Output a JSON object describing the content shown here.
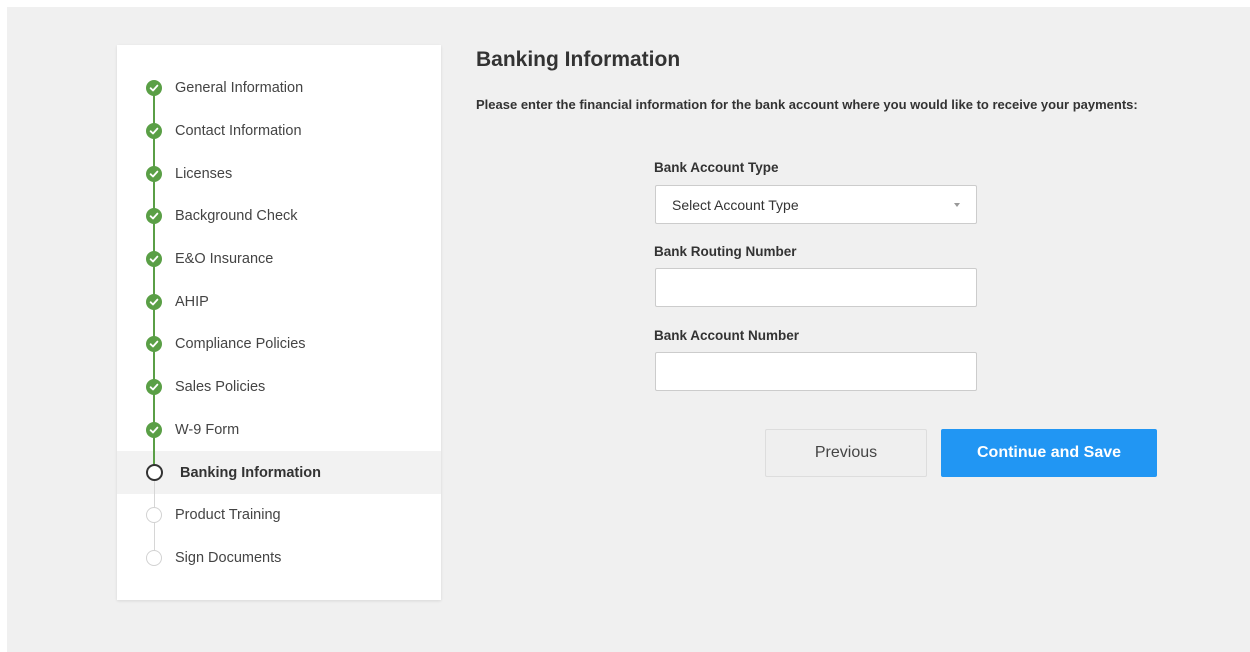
{
  "stepper": {
    "steps": [
      {
        "label": "General Information",
        "status": "done"
      },
      {
        "label": "Contact Information",
        "status": "done"
      },
      {
        "label": "Licenses",
        "status": "done"
      },
      {
        "label": "Background Check",
        "status": "done"
      },
      {
        "label": "E&O Insurance",
        "status": "done"
      },
      {
        "label": "AHIP",
        "status": "done"
      },
      {
        "label": "Compliance Policies",
        "status": "done"
      },
      {
        "label": "Sales Policies",
        "status": "done"
      },
      {
        "label": "W-9 Form",
        "status": "done"
      },
      {
        "label": "Banking Information",
        "status": "active"
      },
      {
        "label": "Product Training",
        "status": "pending"
      },
      {
        "label": "Sign Documents",
        "status": "pending"
      }
    ]
  },
  "main": {
    "title": "Banking Information",
    "intro": "Please enter the financial information for the bank account where you would like to receive your payments:",
    "account_type": {
      "label": "Bank Account Type",
      "selected": "Select Account Type"
    },
    "routing_number": {
      "label": "Bank Routing Number",
      "value": ""
    },
    "account_number": {
      "label": "Bank Account Number",
      "value": ""
    },
    "buttons": {
      "previous": "Previous",
      "continue": "Continue and Save"
    }
  },
  "colors": {
    "complete": "#5a9f46",
    "primary_button": "#2196f3",
    "background": "#f0f0f0"
  }
}
